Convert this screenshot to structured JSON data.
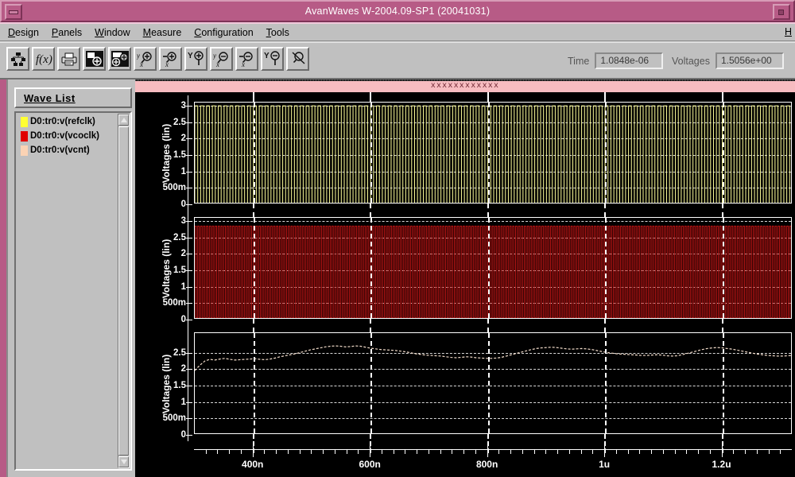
{
  "window": {
    "title": "AvanWaves W-2004.09-SP1 (20041031)",
    "minimize_icon": "minimize-icon",
    "restore_icon": "restore-icon"
  },
  "menubar": {
    "items": [
      {
        "mnemonic": "D",
        "rest": "esign"
      },
      {
        "mnemonic": "P",
        "rest": "anels"
      },
      {
        "mnemonic": "W",
        "rest": "indow"
      },
      {
        "mnemonic": "M",
        "rest": "easure"
      },
      {
        "mnemonic": "C",
        "rest": "onfiguration"
      },
      {
        "mnemonic": "T",
        "rest": "ools"
      }
    ],
    "help": {
      "mnemonic": "H",
      "rest": ""
    }
  },
  "toolbar": {
    "buttons": [
      {
        "icon": "hierarchy-icon",
        "label": "Design Hierarchy"
      },
      {
        "icon": "function-fx-icon",
        "label": "Waveform Calculator"
      },
      {
        "icon": "printer-icon",
        "label": "Print"
      },
      {
        "icon": "panel-add-icon",
        "label": "Add Panel"
      },
      {
        "icon": "panel-add-alt-icon",
        "label": "Add Panel Below"
      },
      {
        "icon": "zoom-in-xy-icon",
        "label": "Zoom In X and Y"
      },
      {
        "icon": "zoom-in-x-icon",
        "label": "Zoom In X"
      },
      {
        "icon": "zoom-in-y-icon",
        "label": "Zoom In Y"
      },
      {
        "icon": "zoom-out-xy-icon",
        "label": "Zoom Out X and Y"
      },
      {
        "icon": "zoom-out-x-icon",
        "label": "Zoom Out X"
      },
      {
        "icon": "zoom-out-y-icon",
        "label": "Zoom Out Y"
      },
      {
        "icon": "zoom-cancel-icon",
        "label": "Cancel Zoom"
      }
    ],
    "time_label": "Time",
    "time_value": "1.0848e-06",
    "voltages_label": "Voltages",
    "voltages_value": "1.5056e+00"
  },
  "sidebar": {
    "header": "Wave List",
    "items": [
      {
        "label": "D0:tr0:v(refclk)",
        "color": "#ffff33"
      },
      {
        "label": "D0:tr0:v(vcoclk)",
        "color": "#e00000"
      },
      {
        "label": "D0:tr0:v(vcnt)",
        "color": "#fbd3b4"
      }
    ],
    "scroll_up_icon": "scroll-up-arrow-icon",
    "scroll_down_icon": "scroll-down-arrow-icon"
  },
  "plot": {
    "title": "xxxxxxxxxxxx",
    "title_bg": "#f7bcc0"
  },
  "chart_data": {
    "type": "line",
    "title": "xxxxxxxxxxxx",
    "xlabel": "",
    "xlim": [
      3e-07,
      1.32e-06
    ],
    "xticks": [
      {
        "value": 4e-07,
        "label": "400n"
      },
      {
        "value": 6e-07,
        "label": "600n"
      },
      {
        "value": 8e-07,
        "label": "800n"
      },
      {
        "value": 1e-06,
        "label": "1u"
      },
      {
        "value": 1.2e-06,
        "label": "1.2u"
      }
    ],
    "grid": true,
    "legend": "none",
    "cursors": [
      {
        "time": 4e-07
      },
      {
        "time": 6e-07
      },
      {
        "time": 8e-07
      },
      {
        "time": 1e-06
      },
      {
        "time": 1.2e-06
      }
    ],
    "panels": [
      {
        "ylabel": "Voltages (lin)",
        "ylim": [
          0,
          3.1
        ],
        "yticks": [
          {
            "value": 3,
            "label": "3"
          },
          {
            "value": 2.5,
            "label": "2.5"
          },
          {
            "value": 2,
            "label": "2"
          },
          {
            "value": 1.5,
            "label": "1.5"
          },
          {
            "value": 1,
            "label": "1"
          },
          {
            "value": 0.5,
            "label": "500m"
          },
          {
            "value": 0,
            "label": "0"
          }
        ],
        "series": [
          {
            "name": "D0:tr0:v(refclk)",
            "color": "#ffff99",
            "waveform": "square",
            "high": 3.0,
            "low": 0.0,
            "period_ns": 10,
            "duty": 0.5,
            "cycles": 102
          }
        ]
      },
      {
        "ylabel": "Voltages (lin)",
        "ylim": [
          0,
          3.1
        ],
        "yticks": [
          {
            "value": 3,
            "label": "3"
          },
          {
            "value": 2.5,
            "label": "2.5"
          },
          {
            "value": 2,
            "label": "2"
          },
          {
            "value": 1.5,
            "label": "1.5"
          },
          {
            "value": 1,
            "label": "1"
          },
          {
            "value": 0.5,
            "label": "500m"
          },
          {
            "value": 0,
            "label": "0"
          }
        ],
        "series": [
          {
            "name": "D0:tr0:v(vcoclk)",
            "color": "#c01414",
            "waveform": "square",
            "high": 2.85,
            "low": 0.05,
            "period_ns": 5,
            "duty": 0.5,
            "cycles": 205
          }
        ]
      },
      {
        "ylabel": "Voltages (lin)",
        "ylim": [
          0,
          3.1
        ],
        "yticks": [
          {
            "value": 2.5,
            "label": "2.5"
          },
          {
            "value": 2,
            "label": "2"
          },
          {
            "value": 1.5,
            "label": "1.5"
          },
          {
            "value": 1,
            "label": "1"
          },
          {
            "value": 0.5,
            "label": "500m"
          },
          {
            "value": 0,
            "label": "0"
          }
        ],
        "series": [
          {
            "name": "D0:tr0:v(vcnt)",
            "color": "#f3ddcb",
            "waveform": "ripple",
            "mean": 2.45,
            "min": 1.95,
            "max": 2.78,
            "points": [
              1.96,
              2.12,
              2.25,
              2.3,
              2.28,
              2.31,
              2.33,
              2.3,
              2.28,
              2.29,
              2.3,
              2.31,
              2.32,
              2.3,
              2.29,
              2.31,
              2.34,
              2.38,
              2.41,
              2.44,
              2.47,
              2.51,
              2.55,
              2.59,
              2.62,
              2.65,
              2.68,
              2.7,
              2.71,
              2.7,
              2.68,
              2.69,
              2.71,
              2.7,
              2.67,
              2.64,
              2.62,
              2.6,
              2.59,
              2.58,
              2.57,
              2.55,
              2.53,
              2.5,
              2.47,
              2.45,
              2.43,
              2.42,
              2.41,
              2.4,
              2.38,
              2.36,
              2.35,
              2.36,
              2.38,
              2.37,
              2.35,
              2.34,
              2.33,
              2.33,
              2.34,
              2.36,
              2.4,
              2.44,
              2.48,
              2.52,
              2.56,
              2.6,
              2.63,
              2.65,
              2.66,
              2.67,
              2.66,
              2.64,
              2.62,
              2.61,
              2.62,
              2.63,
              2.62,
              2.6,
              2.57,
              2.54,
              2.51,
              2.49,
              2.47,
              2.46,
              2.45,
              2.44,
              2.43,
              2.42,
              2.42,
              2.43,
              2.44,
              2.43,
              2.41,
              2.4,
              2.41,
              2.44,
              2.48,
              2.52,
              2.56,
              2.6,
              2.63,
              2.65,
              2.66,
              2.65,
              2.63,
              2.61,
              2.58,
              2.55,
              2.52,
              2.49,
              2.46,
              2.44,
              2.42,
              2.41,
              2.4,
              2.4,
              2.41,
              2.42
            ]
          }
        ]
      }
    ]
  }
}
